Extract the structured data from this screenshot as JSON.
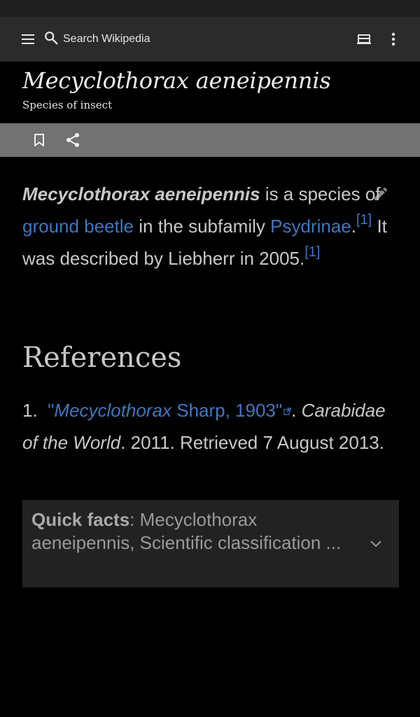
{
  "toolbar": {
    "search_placeholder": "Search Wikipedia",
    "menu_icon": "menu-icon",
    "search_icon": "search-icon",
    "reading_list_icon": "tabs-icon",
    "overflow_icon": "more-vert-icon"
  },
  "page": {
    "title": "Mecyclothorax aeneipennis",
    "subtitle": "Species of insect"
  },
  "actions": {
    "bookmark_icon": "bookmark-icon",
    "share_icon": "share-icon"
  },
  "article": {
    "lead_bold": "Mecyclothorax aeneipennis",
    "text1": " is a species of ",
    "link1": "ground beetle",
    "text2": " in the subfamily ",
    "link2": "Psydrinae",
    "text3": ".",
    "cite1": "[1]",
    "text4": " It was described by Liebherr in 2005.",
    "cite2": "[1]"
  },
  "references": {
    "heading": "References",
    "items": [
      {
        "number": "1.",
        "link_open_quote": "\"",
        "link_italic": "Mecyclothorax",
        "link_rest": " Sharp, 1903\"",
        "after_link": ".",
        "source_italic": "Carabidae of the World",
        "source_rest": ". 2011. Retrieved 7 August 2013."
      }
    ]
  },
  "quick_facts": {
    "label": "Quick facts",
    "text": ": Mecyclothorax aeneipennis, Scientific classification ..."
  },
  "colors": {
    "link": "#3f77c1",
    "toolbar_bg": "#2b2b2b",
    "action_bar_bg": "#727272",
    "quick_facts_bg": "#222222"
  }
}
